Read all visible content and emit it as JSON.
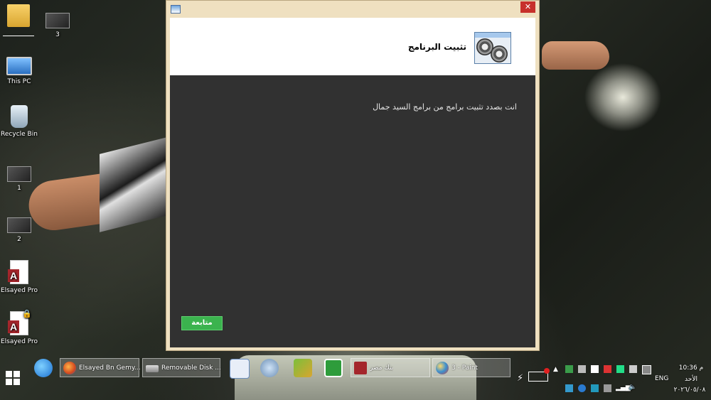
{
  "desktop": {
    "icons": [
      {
        "label": ""
      },
      {
        "label": "3"
      },
      {
        "label": "This PC"
      },
      {
        "label": "Recycle Bin"
      },
      {
        "label": "1"
      },
      {
        "label": "2"
      },
      {
        "label": "Elsayed Pro"
      },
      {
        "label": "Elsayed Pro"
      }
    ]
  },
  "window": {
    "close_glyph": "✕",
    "header_title": "تثبيت البرنامج",
    "message": "انت بصدد تثبيت برامج من برامج السيد جمال",
    "continue_label": "متابعة"
  },
  "taskbar": {
    "tasks": [
      {
        "label": "Elsayed Bn Gemy..."
      },
      {
        "label": "Removable Disk ..."
      },
      {
        "label": "بنك مصر"
      },
      {
        "label": "3 - Paint"
      }
    ],
    "tray": {
      "language": "ENG",
      "time": "10:36 م",
      "day": "الأحد",
      "date": "٢٠٢٦/٠٥/٠٨"
    }
  },
  "colors": {
    "content_bg": "#313131",
    "continue_button": "#3bb34e",
    "close_button": "#c7302b",
    "window_frame": "#efe0c0"
  }
}
